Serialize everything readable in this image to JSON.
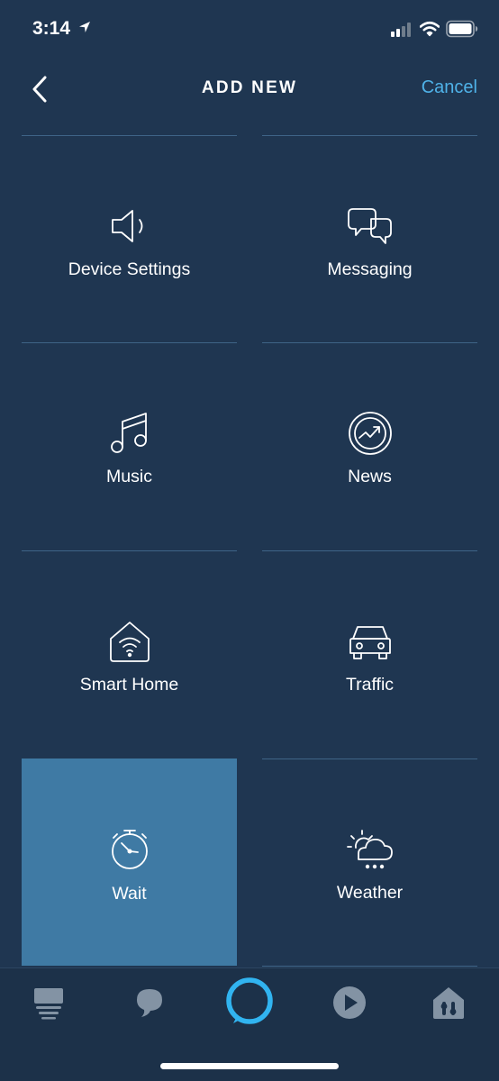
{
  "status_bar": {
    "time": "3:14",
    "icons": [
      "location-arrow-icon",
      "cellular-signal-icon",
      "wifi-icon",
      "battery-icon"
    ]
  },
  "header": {
    "title": "ADD NEW",
    "back_icon": "chevron-left-icon",
    "cancel_label": "Cancel"
  },
  "tiles": [
    {
      "label": "Device Settings",
      "icon": "speaker-icon",
      "selected": false
    },
    {
      "label": "Messaging",
      "icon": "chat-bubbles-icon",
      "selected": false
    },
    {
      "label": "Music",
      "icon": "music-note-icon",
      "selected": false
    },
    {
      "label": "News",
      "icon": "news-trend-icon",
      "selected": false
    },
    {
      "label": "Smart Home",
      "icon": "house-wifi-icon",
      "selected": false
    },
    {
      "label": "Traffic",
      "icon": "car-icon",
      "selected": false
    },
    {
      "label": "Wait",
      "icon": "alarm-clock-icon",
      "selected": true
    },
    {
      "label": "Weather",
      "icon": "sun-cloud-icon",
      "selected": false
    }
  ],
  "bottom_nav": {
    "items": [
      {
        "icon": "home-feed-icon"
      },
      {
        "icon": "communicate-icon"
      },
      {
        "icon": "alexa-ring-icon"
      },
      {
        "icon": "play-icon"
      },
      {
        "icon": "devices-icon"
      }
    ]
  },
  "colors": {
    "background": "#1f3651",
    "selected_tile": "#3f7aa4",
    "divider": "#3f6487",
    "accent": "#4fb2e8",
    "nav_icon": "#8393a4"
  }
}
